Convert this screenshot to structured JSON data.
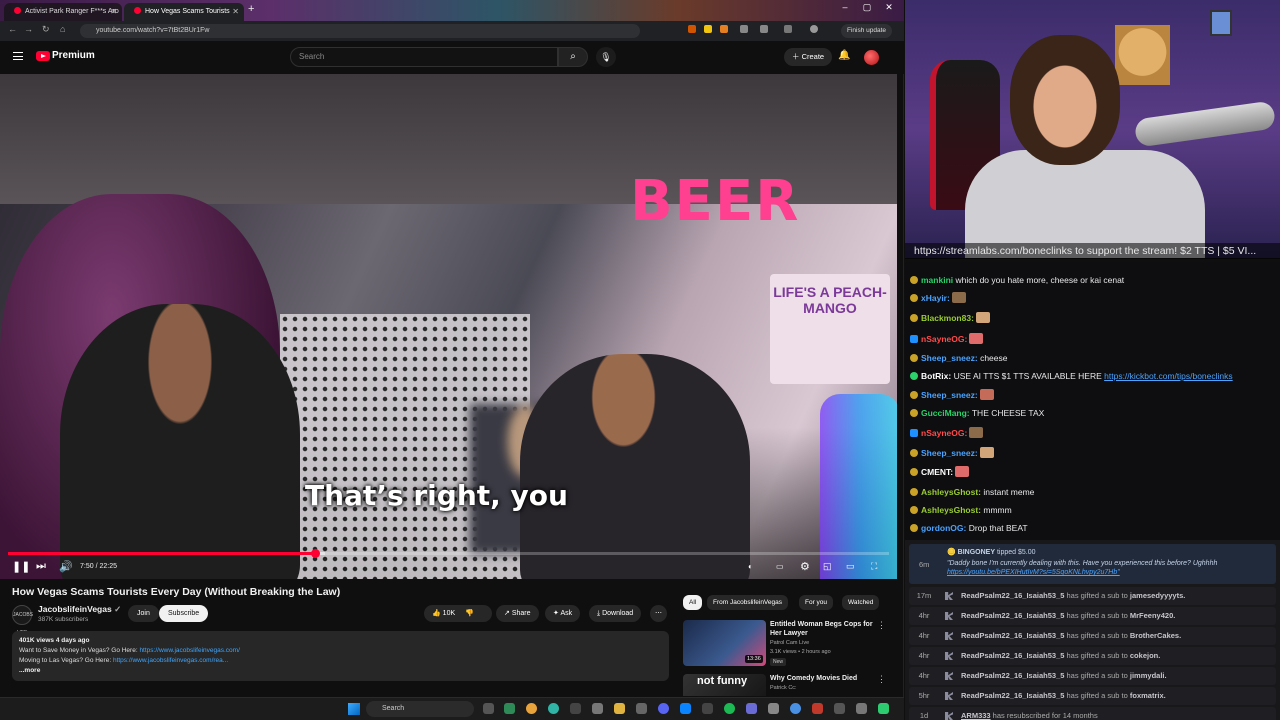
{
  "browser": {
    "tabs": [
      {
        "label": "Activist Park Ranger F***s Aro"
      },
      {
        "label": "How Vegas Scams Tourists"
      }
    ],
    "new_tab": "+",
    "url": "youtube.com/watch?v=7tBt2BUr1Fw",
    "finish_update": "Finish update",
    "window_controls": [
      "–",
      "▢",
      "✕"
    ]
  },
  "masthead": {
    "brand": "Premium",
    "search_placeholder": "Search",
    "create_label": "Create"
  },
  "video": {
    "caption": "That’s right, you",
    "sign_text": "BEER",
    "sign_peach": "LIFE'S A PEACH-MANGO",
    "time": "7:50 / 22:25",
    "progress_fraction": 0.349,
    "buffered_fraction": 0.36
  },
  "details": {
    "title": "How Vegas Scams Tourists Every Day (Without Breaking the Law)",
    "channel_name": "JacobslifeinVegas",
    "channel_avatar_text": "JACOBS LIFE",
    "subscribers": "387K subscribers",
    "join_label": "Join",
    "subscribe_label": "Subscribe",
    "likes": "10K",
    "share_label": "Share",
    "ask_label": "Ask",
    "download_label": "Download",
    "more_actions": "⋯",
    "desc_meta": "401K views  4 days ago",
    "desc_line1_text": "Want to Save Money in Vegas? Go Here: ",
    "desc_line1_link": "https://www.jacobslifeinvegas.com/",
    "desc_line2_text": "Moving to Las Vegas? Go Here: ",
    "desc_line2_link": "https://www.jacobslifeinvegas.com/rea...",
    "desc_more": "...more"
  },
  "recommendations": {
    "chips": [
      "All",
      "From JacobslifeinVegas",
      "For you",
      "Watched"
    ],
    "items": [
      {
        "title": "Entitled Woman Begs Cops for Her Lawyer",
        "channel": "Patrol Cam Live",
        "meta": "3.1K views • 2 hours ago",
        "badge": "New",
        "duration": "13:36"
      },
      {
        "title": "Why Comedy Movies Died",
        "channel": "Patrick Cc:",
        "thumb_text": "not funny"
      }
    ]
  },
  "stream": {
    "overlay_text": "https://streamlabs.com/boneclinks to support the stream! $2 TTS | $5 VI..."
  },
  "chat": [
    {
      "user": "mankini",
      "color": "#2bd26b",
      "text": " which do you hate more, cheese or kai cenat"
    },
    {
      "user": "xHayir:",
      "color": "#4aa3ff",
      "text": ""
    },
    {
      "user": "Blackmon83:",
      "color": "#9acd32",
      "text": ""
    },
    {
      "user": "nSayneOG:",
      "color": "#ff4b4b",
      "text": ""
    },
    {
      "user": "Sheep_sneez:",
      "color": "#4aa3ff",
      "text": " cheese"
    },
    {
      "user": "BotRix:",
      "color": "#ffffff",
      "text": " USE AI TTS $1 TTS AVAILABLE HERE ",
      "link": "https://kickbot.com/tips/boneclinks"
    },
    {
      "user": "Sheep_sneez:",
      "color": "#4aa3ff",
      "text": ""
    },
    {
      "user": "GucciMang:",
      "color": "#2bd26b",
      "text": " THE CHEESE TAX"
    },
    {
      "user": "nSayneOG:",
      "color": "#ff4b4b",
      "text": ""
    },
    {
      "user": "Sheep_sneez:",
      "color": "#4aa3ff",
      "text": ""
    },
    {
      "user": "CMENT:",
      "color": "#ffffff",
      "text": ""
    },
    {
      "user": "AshleysGhost:",
      "color": "#9acd32",
      "text": " instant meme"
    },
    {
      "user": "AshleysGhost:",
      "color": "#9acd32",
      "text": " mmmm"
    },
    {
      "user": "gordonOG:",
      "color": "#4aa3ff",
      "text": " Drop that BEAT"
    }
  ],
  "events": {
    "tip": {
      "ago": "6m",
      "user": "BINGONEY",
      "amount_text": "tipped $5.00",
      "message": "\"Daddy bone I'm currently dealing with this. Have you experienced this before? Ughhhh",
      "link": "https://youtu.be/bPEXIHutIvM?si=5SqoKNLhvpy2u7Hb\""
    },
    "subs": [
      {
        "ago": "17m",
        "user": "ReadPsalm22_16_Isaiah53_5",
        "mid": " has gifted a sub to ",
        "target": "jamesedyyyyts."
      },
      {
        "ago": "4hr",
        "user": "ReadPsalm22_16_Isaiah53_5",
        "mid": " has gifted a sub to ",
        "target": "MrFeeny420."
      },
      {
        "ago": "4hr",
        "user": "ReadPsalm22_16_Isaiah53_5",
        "mid": " has gifted a sub to ",
        "target": "BrotherCakes."
      },
      {
        "ago": "4hr",
        "user": "ReadPsalm22_16_Isaiah53_5",
        "mid": " has gifted a sub to ",
        "target": "cokejon."
      },
      {
        "ago": "4hr",
        "user": "ReadPsalm22_16_Isaiah53_5",
        "mid": " has gifted a sub to ",
        "target": "jimmydali."
      },
      {
        "ago": "5hr",
        "user": "ReadPsalm22_16_Isaiah53_5",
        "mid": " has gifted a sub to ",
        "target": "foxmatrix."
      },
      {
        "ago": "1d",
        "user": "ARM333",
        "mid": " has resubscribed for 14 months",
        "target": ""
      }
    ]
  },
  "taskbar": {
    "search_placeholder": "Search"
  },
  "colors": {
    "accent": "#ff0033",
    "link": "#3ea6ff"
  }
}
